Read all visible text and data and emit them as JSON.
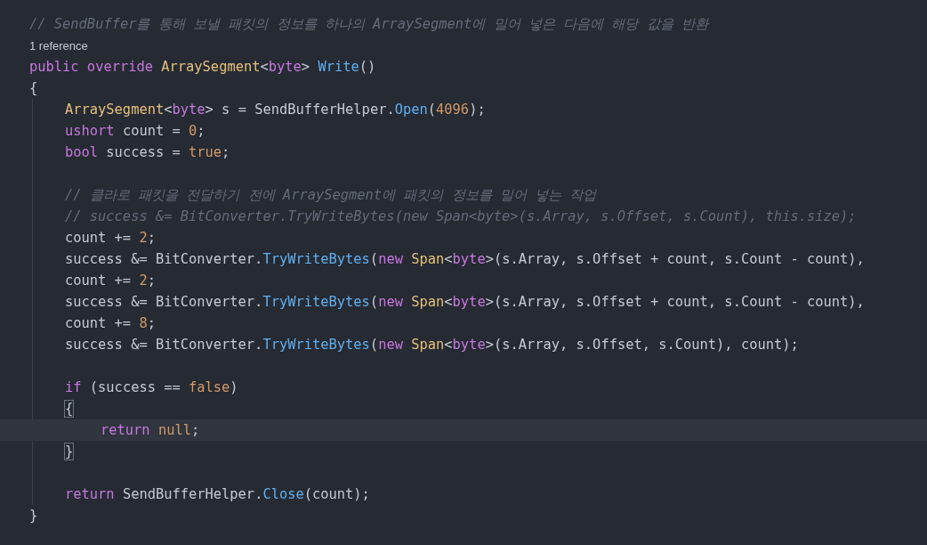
{
  "editor": {
    "lines": [
      {
        "kind": "code",
        "current": false,
        "tokens": [
          {
            "text": "// SendBuffer를 통해 보낼 패킷의 정보를 하나의 ArraySegment에 밀어 넣은 다음에 해당 값을 반환",
            "kind": "comment"
          }
        ]
      },
      {
        "kind": "codelens",
        "current": false,
        "tokens": [
          {
            "text": "1 reference",
            "kind": "plain"
          }
        ]
      },
      {
        "kind": "code",
        "current": false,
        "tokens": [
          {
            "text": "public override ",
            "kind": "keyword"
          },
          {
            "text": "ArraySegment",
            "kind": "type"
          },
          {
            "text": "<",
            "kind": "plain"
          },
          {
            "text": "byte",
            "kind": "keyword"
          },
          {
            "text": "> ",
            "kind": "plain"
          },
          {
            "text": "Write",
            "kind": "method"
          },
          {
            "text": "()",
            "kind": "plain"
          }
        ]
      },
      {
        "kind": "code",
        "current": false,
        "tokens": [
          {
            "text": "{",
            "kind": "plain"
          }
        ],
        "children": [
          {
            "kind": "code",
            "current": false,
            "tokens": [
              {
                "text": "ArraySegment",
                "kind": "type"
              },
              {
                "text": "<",
                "kind": "plain"
              },
              {
                "text": "byte",
                "kind": "keyword"
              },
              {
                "text": "> s = SendBufferHelper.",
                "kind": "plain"
              },
              {
                "text": "Open",
                "kind": "method"
              },
              {
                "text": "(",
                "kind": "plain"
              },
              {
                "text": "4096",
                "kind": "number"
              },
              {
                "text": ");",
                "kind": "plain"
              }
            ]
          },
          {
            "kind": "code",
            "current": false,
            "tokens": [
              {
                "text": "ushort",
                "kind": "keyword"
              },
              {
                "text": " count = ",
                "kind": "plain"
              },
              {
                "text": "0",
                "kind": "number"
              },
              {
                "text": ";",
                "kind": "plain"
              }
            ]
          },
          {
            "kind": "code",
            "current": false,
            "tokens": [
              {
                "text": "bool",
                "kind": "keyword"
              },
              {
                "text": " success = ",
                "kind": "plain"
              },
              {
                "text": "true",
                "kind": "number"
              },
              {
                "text": ";",
                "kind": "plain"
              }
            ]
          },
          {
            "kind": "blank",
            "current": false
          },
          {
            "kind": "code",
            "current": false,
            "tokens": [
              {
                "text": "// 클라로 패킷을 전달하기 전에 ArraySegment에 패킷의 정보를 밀어 넣는 작업",
                "kind": "comment"
              }
            ]
          },
          {
            "kind": "code",
            "current": false,
            "tokens": [
              {
                "text": "// success &= BitConverter.TryWriteBytes(new Span<byte>(s.Array, s.Offset, s.Count), this.size);",
                "kind": "comment"
              }
            ]
          },
          {
            "kind": "code",
            "current": false,
            "tokens": [
              {
                "text": "count += ",
                "kind": "plain"
              },
              {
                "text": "2",
                "kind": "number"
              },
              {
                "text": ";",
                "kind": "plain"
              }
            ]
          },
          {
            "kind": "code",
            "current": false,
            "tokens": [
              {
                "text": "success &= BitConverter.",
                "kind": "plain"
              },
              {
                "text": "TryWriteBytes",
                "kind": "method"
              },
              {
                "text": "(",
                "kind": "plain"
              },
              {
                "text": "new ",
                "kind": "keyword"
              },
              {
                "text": "Span",
                "kind": "type"
              },
              {
                "text": "<",
                "kind": "plain"
              },
              {
                "text": "byte",
                "kind": "keyword"
              },
              {
                "text": ">(s.Array, s.Offset + count, s.Count - count),",
                "kind": "plain"
              }
            ]
          },
          {
            "kind": "code",
            "current": false,
            "tokens": [
              {
                "text": "count += ",
                "kind": "plain"
              },
              {
                "text": "2",
                "kind": "number"
              },
              {
                "text": ";",
                "kind": "plain"
              }
            ]
          },
          {
            "kind": "code",
            "current": false,
            "tokens": [
              {
                "text": "success &= BitConverter.",
                "kind": "plain"
              },
              {
                "text": "TryWriteBytes",
                "kind": "method"
              },
              {
                "text": "(",
                "kind": "plain"
              },
              {
                "text": "new ",
                "kind": "keyword"
              },
              {
                "text": "Span",
                "kind": "type"
              },
              {
                "text": "<",
                "kind": "plain"
              },
              {
                "text": "byte",
                "kind": "keyword"
              },
              {
                "text": ">(s.Array, s.Offset + count, s.Count - count),",
                "kind": "plain"
              }
            ]
          },
          {
            "kind": "code",
            "current": false,
            "tokens": [
              {
                "text": "count += ",
                "kind": "plain"
              },
              {
                "text": "8",
                "kind": "number"
              },
              {
                "text": ";",
                "kind": "plain"
              }
            ]
          },
          {
            "kind": "code",
            "current": false,
            "tokens": [
              {
                "text": "success &= BitConverter.",
                "kind": "plain"
              },
              {
                "text": "TryWriteBytes",
                "kind": "method"
              },
              {
                "text": "(",
                "kind": "plain"
              },
              {
                "text": "new ",
                "kind": "keyword"
              },
              {
                "text": "Span",
                "kind": "type"
              },
              {
                "text": "<",
                "kind": "plain"
              },
              {
                "text": "byte",
                "kind": "keyword"
              },
              {
                "text": ">(s.Array, s.Offset, s.Count), count);",
                "kind": "plain"
              }
            ]
          },
          {
            "kind": "blank",
            "current": false
          },
          {
            "kind": "code",
            "current": false,
            "tokens": [
              {
                "text": "if",
                "kind": "keyword"
              },
              {
                "text": " (success == ",
                "kind": "plain"
              },
              {
                "text": "false",
                "kind": "number"
              },
              {
                "text": ")",
                "kind": "plain"
              }
            ]
          },
          {
            "kind": "code",
            "current": false,
            "tokens": [
              {
                "text": "{",
                "kind": "brace_match"
              }
            ],
            "children": [
              {
                "kind": "code",
                "current": true,
                "tokens": [
                  {
                    "text": "return ",
                    "kind": "keyword"
                  },
                  {
                    "text": "null",
                    "kind": "number"
                  },
                  {
                    "text": ";",
                    "kind": "plain"
                  }
                ]
              }
            ]
          },
          {
            "kind": "code",
            "current": false,
            "tokens": [
              {
                "text": "}",
                "kind": "brace_match"
              }
            ]
          },
          {
            "kind": "blank",
            "current": false
          },
          {
            "kind": "code",
            "current": false,
            "tokens": [
              {
                "text": "return",
                "kind": "keyword"
              },
              {
                "text": " SendBufferHelper.",
                "kind": "plain"
              },
              {
                "text": "Close",
                "kind": "method"
              },
              {
                "text": "(count);",
                "kind": "plain"
              }
            ]
          }
        ]
      },
      {
        "kind": "code",
        "current": false,
        "tokens": [
          {
            "text": "}",
            "kind": "plain"
          }
        ]
      }
    ]
  }
}
